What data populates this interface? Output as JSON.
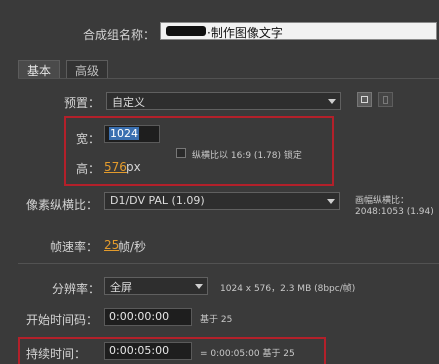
{
  "comp_name": {
    "label": "合成组名称：",
    "value": "·制作图像文字"
  },
  "tabs": [
    "基本",
    "高级"
  ],
  "preset": {
    "label": "预置：",
    "value": "自定义"
  },
  "size": {
    "width_label": "宽：",
    "width_value": "1024",
    "height_label": "高：",
    "height_value": "576",
    "height_unit": "px",
    "lock_label": "纵横比以 16:9 (1.78) 锁定"
  },
  "pixel_aspect": {
    "label": "像素纵横比：",
    "value": "D1/DV PAL (1.09)"
  },
  "frame_aspect": {
    "label": "画幅纵横比：",
    "value": "2048:1053 (1.94)"
  },
  "frame_rate": {
    "label": "帧速率：",
    "value": "25",
    "unit": "帧/秒"
  },
  "resolution": {
    "label": "分辨率：",
    "value": "全屏",
    "info": "1024 x 576，2.3 MB (8bpc/帧)"
  },
  "start_timecode": {
    "label": "开始时间码：",
    "value": "0:00:00:00",
    "base": "基于 25"
  },
  "duration": {
    "label": "持续时间：",
    "value": "0:00:05:00",
    "equals": "= 0:00:05:00  基于 25"
  },
  "colors": {
    "accent_red": "#b3202a",
    "highlight_orange": "#e39b2c",
    "selection_blue": "#3a6fb0"
  }
}
